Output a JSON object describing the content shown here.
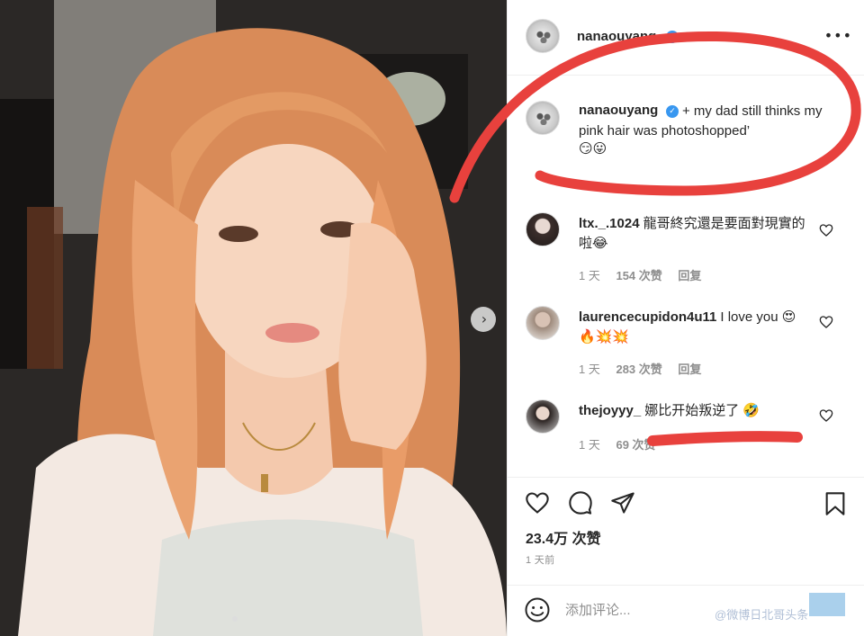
{
  "post": {
    "owner_username": "nanaouyang",
    "caption_username": "nanaouyang",
    "caption": "+ my dad still thinks my pink hair was photoshopped’",
    "caption_emojis": "😏😛",
    "more_label": "•••"
  },
  "comments": [
    {
      "username": "ltx._.1024",
      "text": "龍哥終究還是要面對現實的啦😂",
      "time": "1 天",
      "likes": "154 次赞",
      "reply": "回复"
    },
    {
      "username": "laurencecupidon4u11",
      "text": "I love you 😍🔥💥💥",
      "time": "1 天",
      "likes": "283 次赞",
      "reply": "回复"
    },
    {
      "username": "thejoyyy_",
      "text": "娜比开始叛逆了 🤣",
      "time": "1 天",
      "likes": "69 次赞",
      "reply": ""
    }
  ],
  "stats": {
    "likes": "23.4万 次赞",
    "time_ago": "1 天前"
  },
  "add_comment": {
    "placeholder": "添加评论...",
    "watermark": "@微博日北哥头条"
  },
  "icons": {
    "next": "chevron-right-icon",
    "like": "heart-icon",
    "comment": "speech-bubble-icon",
    "share": "paper-plane-icon",
    "save": "bookmark-icon",
    "emoji": "smiley-icon",
    "verified": "verified-badge-icon",
    "more": "more-dots-icon"
  },
  "colors": {
    "annotation_red": "#e8413d",
    "verified_blue": "#3897f0",
    "hair": "#e89a6a"
  }
}
